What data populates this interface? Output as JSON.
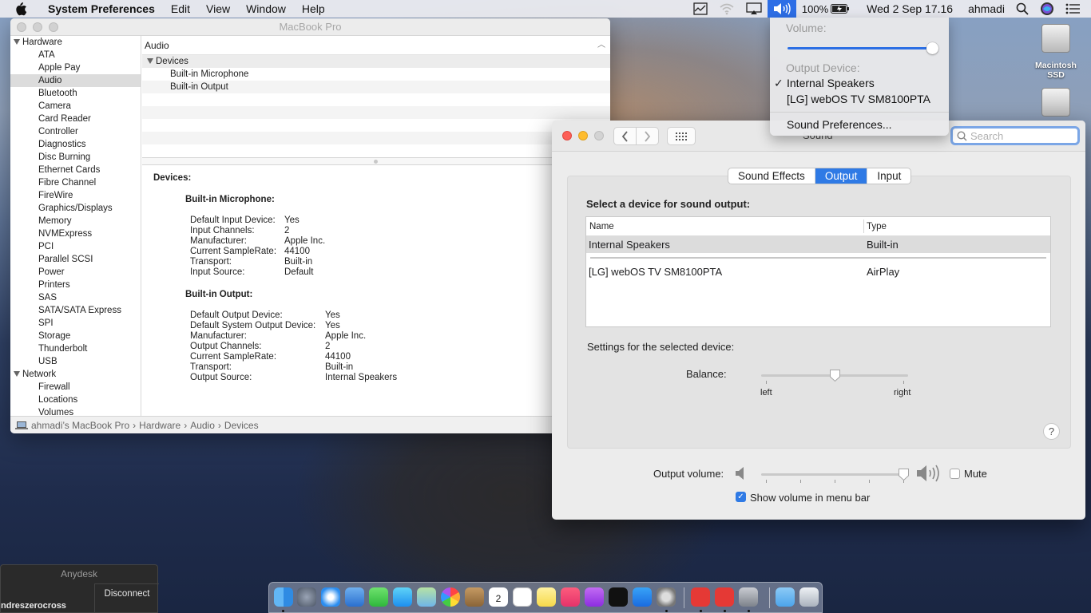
{
  "menubar": {
    "app_name": "System Preferences",
    "menus": [
      "Edit",
      "View",
      "Window",
      "Help"
    ],
    "battery": "100%",
    "datetime": "Wed 2 Sep  17.16",
    "user": "ahmadi"
  },
  "volume_menu": {
    "volume_label": "Volume:",
    "volume_level": 1.0,
    "output_device_label": "Output Device:",
    "devices": [
      "Internal Speakers",
      "[LG] webOS TV SM8100PTA"
    ],
    "selected_device": "Internal Speakers",
    "check": "✓",
    "sound_prefs": "Sound Preferences..."
  },
  "sysinfo": {
    "window_title": "MacBook Pro",
    "sidebar": {
      "hardware_label": "Hardware",
      "hardware_items": [
        "ATA",
        "Apple Pay",
        "Audio",
        "Bluetooth",
        "Camera",
        "Card Reader",
        "Controller",
        "Diagnostics",
        "Disc Burning",
        "Ethernet Cards",
        "Fibre Channel",
        "FireWire",
        "Graphics/Displays",
        "Memory",
        "NVMExpress",
        "PCI",
        "Parallel SCSI",
        "Power",
        "Printers",
        "SAS",
        "SATA/SATA Express",
        "SPI",
        "Storage",
        "Thunderbolt",
        "USB"
      ],
      "selected": "Audio",
      "network_label": "Network",
      "network_items": [
        "Firewall",
        "Locations",
        "Volumes"
      ]
    },
    "list": {
      "header": "Audio",
      "group": "Devices",
      "items": [
        "Built-in Microphone",
        "Built-in Output"
      ]
    },
    "detail": {
      "heading": "Devices:",
      "mic": {
        "title": "Built-in Microphone:",
        "rows": [
          {
            "k": "Default Input Device:",
            "v": "Yes"
          },
          {
            "k": "Input Channels:",
            "v": "2"
          },
          {
            "k": "Manufacturer:",
            "v": "Apple Inc."
          },
          {
            "k": "Current SampleRate:",
            "v": "44100"
          },
          {
            "k": "Transport:",
            "v": "Built-in"
          },
          {
            "k": "Input Source:",
            "v": "Default"
          }
        ]
      },
      "out": {
        "title": "Built-in Output:",
        "rows": [
          {
            "k": "Default Output Device:",
            "v": "Yes"
          },
          {
            "k": "Default System Output Device:",
            "v": "Yes"
          },
          {
            "k": "Manufacturer:",
            "v": "Apple Inc."
          },
          {
            "k": "Output Channels:",
            "v": "2"
          },
          {
            "k": "Current SampleRate:",
            "v": "44100"
          },
          {
            "k": "Transport:",
            "v": "Built-in"
          },
          {
            "k": "Output Source:",
            "v": "Internal Speakers"
          }
        ]
      }
    },
    "path": [
      "ahmadi’s MacBook Pro",
      "Hardware",
      "Audio",
      "Devices"
    ],
    "path_sep": "›"
  },
  "sound": {
    "window_title": "Sound",
    "search_placeholder": "Search",
    "tabs": [
      "Sound Effects",
      "Output",
      "Input"
    ],
    "active_tab": "Output",
    "select_label": "Select a device for sound output:",
    "table": {
      "col_name": "Name",
      "col_type": "Type",
      "rows": [
        {
          "name": "Internal Speakers",
          "type": "Built-in"
        },
        {
          "name": "[LG] webOS TV SM8100PTA",
          "type": "AirPlay"
        }
      ],
      "selected_row": 0
    },
    "settings_label": "Settings for the selected device:",
    "balance_label": "Balance:",
    "balance_left": "left",
    "balance_right": "right",
    "balance_value": 0.5,
    "help": "?",
    "output_volume_label": "Output volume:",
    "output_volume": 0.97,
    "mute_label": "Mute",
    "mute_checked": false,
    "show_volume_label": "Show volume in menu bar",
    "show_volume_checked": true
  },
  "desktop": {
    "disk1_label": "Macintosh SSD"
  },
  "anydesk": {
    "title": "Anydesk",
    "user": "ndreszerocross",
    "disconnect": "Disconnect"
  },
  "dock": {
    "calendar_day": "2"
  }
}
